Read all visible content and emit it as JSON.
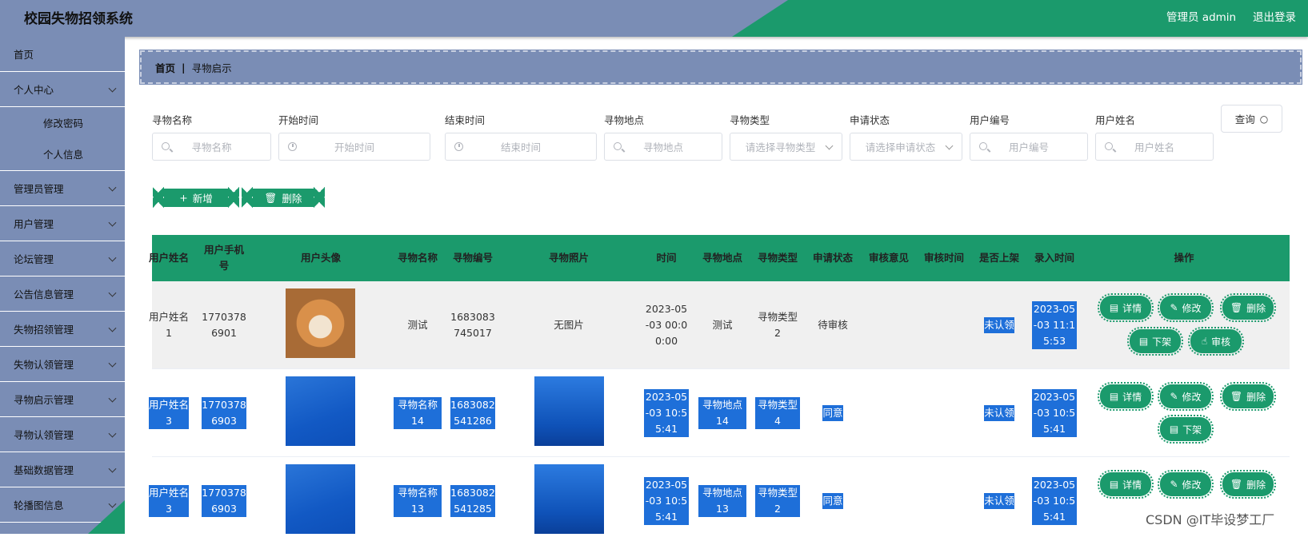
{
  "header": {
    "title": "校园失物招领系统",
    "admin": "管理员 admin",
    "logout": "退出登录"
  },
  "sidebar": {
    "items": [
      {
        "label": "首页"
      },
      {
        "label": "个人中心"
      },
      {
        "label": "修改密码"
      },
      {
        "label": "个人信息"
      },
      {
        "label": "管理员管理"
      },
      {
        "label": "用户管理"
      },
      {
        "label": "论坛管理"
      },
      {
        "label": "公告信息管理"
      },
      {
        "label": "失物招领管理"
      },
      {
        "label": "失物认领管理"
      },
      {
        "label": "寻物启示管理"
      },
      {
        "label": "寻物认领管理"
      },
      {
        "label": "基础数据管理"
      },
      {
        "label": "轮播图信息"
      }
    ]
  },
  "breadcrumb": {
    "home": "首页",
    "sep": "|",
    "current": "寻物启示"
  },
  "filters": [
    {
      "label": "寻物名称",
      "placeholder": "寻物名称"
    },
    {
      "label": "开始时间",
      "placeholder": "开始时间"
    },
    {
      "label": "结束时间",
      "placeholder": "结束时间"
    },
    {
      "label": "寻物地点",
      "placeholder": "寻物地点"
    },
    {
      "label": "寻物类型",
      "placeholder": "请选择寻物类型"
    },
    {
      "label": "申请状态",
      "placeholder": "请选择申请状态"
    },
    {
      "label": "用户编号",
      "placeholder": "用户编号"
    },
    {
      "label": "用户姓名",
      "placeholder": "用户姓名"
    }
  ],
  "query_label": "查询",
  "actions": {
    "add": "新增",
    "delete": "删除"
  },
  "table": {
    "headers": [
      "用户姓名",
      "用户手机号",
      "用户头像",
      "寻物名称",
      "寻物编号",
      "寻物照片",
      "时间",
      "寻物地点",
      "寻物类型",
      "申请状态",
      "审核意见",
      "审核时间",
      "是否上架",
      "录入时间",
      "操作"
    ],
    "rows": [
      {
        "name": "用户姓名1",
        "phone": "17703786901",
        "item": "测试",
        "code": "1683083745017",
        "photo": "无图片",
        "time": "2023-05-03 00:00:00",
        "place": "测试",
        "type": "寻物类型2",
        "status": "待审核",
        "shelf": "未认领",
        "entry": "2023-05-03 11:15:53"
      },
      {
        "name": "用户姓名3",
        "phone": "17703786903",
        "item": "寻物名称14",
        "code": "1683082541286",
        "photo": "",
        "time": "2023-05-03 10:55:41",
        "place": "寻物地点14",
        "type": "寻物类型4",
        "status": "同意",
        "shelf": "未认领",
        "entry": "2023-05-03 10:55:41"
      },
      {
        "name": "用户姓名3",
        "phone": "17703786903",
        "item": "寻物名称13",
        "code": "1683082541285",
        "photo": "",
        "time": "2023-05-03 10:55:41",
        "place": "寻物地点13",
        "type": "寻物类型2",
        "status": "同意",
        "shelf": "未认领",
        "entry": "2023-05-03 10:55:41"
      }
    ],
    "ops": {
      "detail": "详情",
      "edit": "修改",
      "delete": "删除",
      "unshelf": "下架",
      "review": "审核"
    }
  },
  "watermark": "CSDN @IT毕设梦工厂",
  "colors": {
    "accent": "#1b9a6c",
    "nav": "#7a8db5",
    "selection": "#1e6fd9"
  }
}
